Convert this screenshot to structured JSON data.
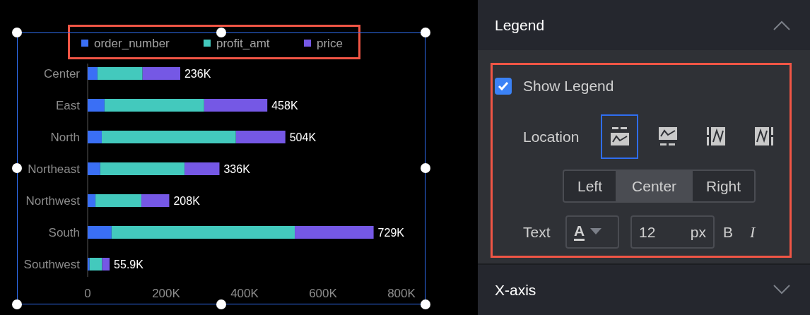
{
  "chart": {
    "selected": true,
    "chart_data": {
      "type": "bar",
      "orientation": "horizontal",
      "stacked": true,
      "legend": "top",
      "categories": [
        "Center",
        "East",
        "North",
        "Northeast",
        "Northwest",
        "South",
        "Southwest"
      ],
      "series": [
        {
          "name": "order_number",
          "color": "#3a6ff5",
          "values": [
            25,
            43,
            36,
            32,
            20,
            61,
            5
          ]
        },
        {
          "name": "profit_amt",
          "color": "#43c9bd",
          "values": [
            115,
            254,
            342,
            215,
            117,
            467,
            32
          ]
        },
        {
          "name": "price",
          "color": "#7558e5",
          "values": [
            96,
            161,
            126,
            89,
            71,
            201,
            19
          ]
        }
      ],
      "xlim": [
        0,
        800
      ],
      "xticks": [
        {
          "value": 0,
          "label": "0"
        },
        {
          "value": 200,
          "label": "200K"
        },
        {
          "value": 400,
          "label": "400K"
        },
        {
          "value": 600,
          "label": "600K"
        },
        {
          "value": 800,
          "label": "800K"
        }
      ],
      "value_labels": [
        "236K",
        "458K",
        "504K",
        "336K",
        "208K",
        "729K",
        "55.9K"
      ]
    }
  },
  "sections": [
    {
      "title": "Legend",
      "expanded": true
    },
    {
      "title": "X-axis",
      "expanded": false
    }
  ],
  "legend_settings": {
    "show_legend": {
      "label": "Show Legend",
      "checked": true
    },
    "location": {
      "label": "Location",
      "options": [
        {
          "kind": "top",
          "selected": true
        },
        {
          "kind": "bottom",
          "selected": false
        },
        {
          "kind": "left",
          "selected": false
        },
        {
          "kind": "right",
          "selected": false
        }
      ]
    },
    "alignment": [
      {
        "label": "Left",
        "selected": false
      },
      {
        "label": "Center",
        "selected": true
      },
      {
        "label": "Right",
        "selected": false
      }
    ],
    "text": {
      "label": "Text",
      "color_glyph": "A",
      "font_size": "12",
      "unit": "px",
      "bold_glyph": "B",
      "italic_glyph": "I"
    }
  }
}
